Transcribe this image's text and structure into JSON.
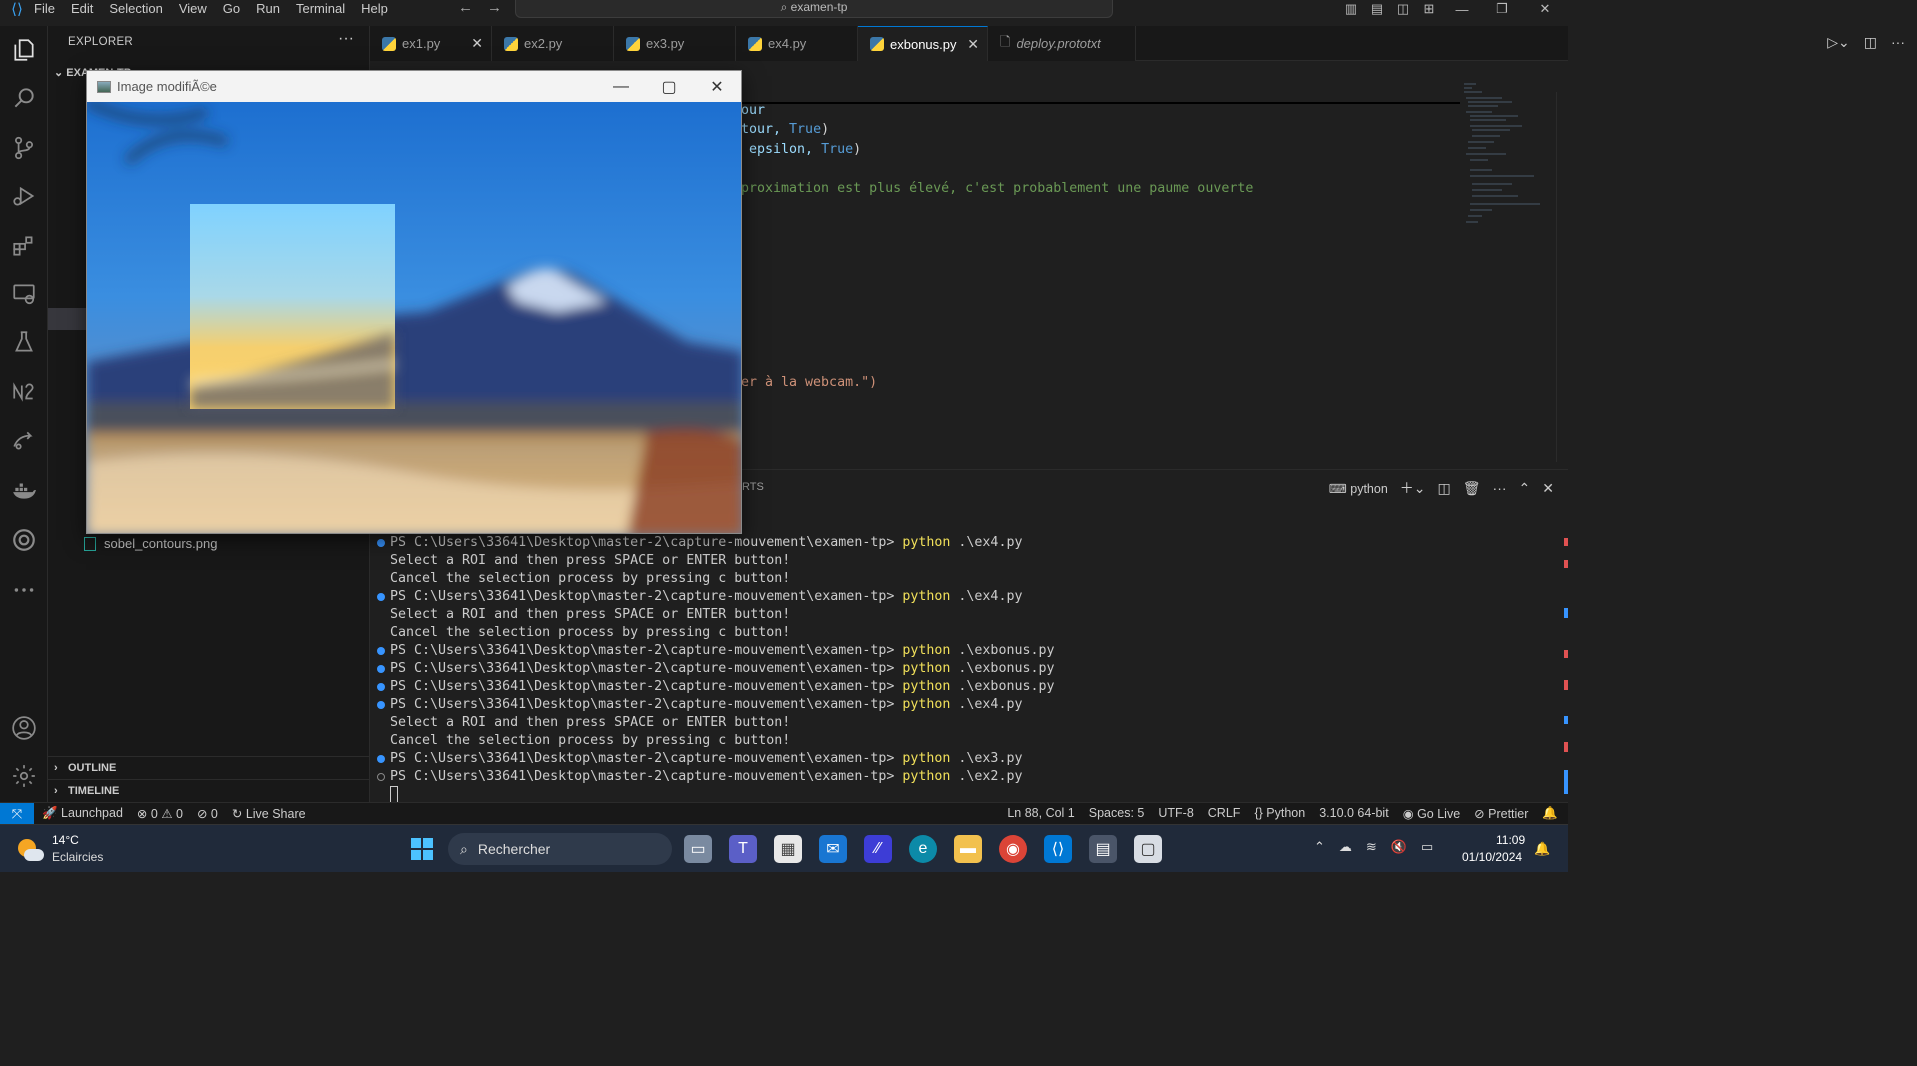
{
  "titlebar": {
    "menu": [
      "File",
      "Edit",
      "Selection",
      "View",
      "Go",
      "Run",
      "Terminal",
      "Help"
    ],
    "search": "examen-tp"
  },
  "sidebar": {
    "header": "EXPLORER",
    "folder": "EXAMEN-TP",
    "file": "sobel_contours.png",
    "outline": "OUTLINE",
    "timeline": "TIMELINE"
  },
  "tabs": [
    {
      "label": "ex1.py",
      "active": false
    },
    {
      "label": "ex2.py",
      "active": false
    },
    {
      "label": "ex3.py",
      "active": false
    },
    {
      "label": "ex4.py",
      "active": false
    },
    {
      "label": "exbonus.py",
      "active": true
    },
    {
      "label": "deploy.prototxt",
      "active": false
    }
  ],
  "code": {
    "line1": "our",
    "line2_a": "tour, ",
    "line2_b": "True",
    "line2_c": ")",
    "line3_a": " epsilon, ",
    "line3_b": "True",
    "line3_c": ")",
    "line4": "proximation est plus élevé, c'est probablement une paume ouverte",
    "line5": "er à la webcam.\")"
  },
  "panel": {
    "tab_partial": "RTS",
    "terminal_name": "python"
  },
  "terminal": [
    {
      "prompt": "PS C:\\Users\\33641\\Desktop\\master-2\\capture-mouvement\\examen-tp> ",
      "cmd": "python",
      "arg": " .\\ex4.py",
      "dot": "filled"
    },
    {
      "text": "Select a ROI and then press SPACE or ENTER button!"
    },
    {
      "text": "Cancel the selection process by pressing c button!"
    },
    {
      "prompt": "PS C:\\Users\\33641\\Desktop\\master-2\\capture-mouvement\\examen-tp> ",
      "cmd": "python",
      "arg": " .\\ex4.py",
      "dot": "filled"
    },
    {
      "text": "Select a ROI and then press SPACE or ENTER button!"
    },
    {
      "text": "Cancel the selection process by pressing c button!"
    },
    {
      "prompt": "PS C:\\Users\\33641\\Desktop\\master-2\\capture-mouvement\\examen-tp> ",
      "cmd": "python",
      "arg": " .\\exbonus.py",
      "dot": "filled"
    },
    {
      "prompt": "PS C:\\Users\\33641\\Desktop\\master-2\\capture-mouvement\\examen-tp> ",
      "cmd": "python",
      "arg": " .\\exbonus.py",
      "dot": "filled"
    },
    {
      "prompt": "PS C:\\Users\\33641\\Desktop\\master-2\\capture-mouvement\\examen-tp> ",
      "cmd": "python",
      "arg": " .\\exbonus.py",
      "dot": "filled"
    },
    {
      "prompt": "PS C:\\Users\\33641\\Desktop\\master-2\\capture-mouvement\\examen-tp> ",
      "cmd": "python",
      "arg": " .\\ex4.py",
      "dot": "filled"
    },
    {
      "text": "Select a ROI and then press SPACE or ENTER button!"
    },
    {
      "text": "Cancel the selection process by pressing c button!"
    },
    {
      "prompt": "PS C:\\Users\\33641\\Desktop\\master-2\\capture-mouvement\\examen-tp> ",
      "cmd": "python",
      "arg": " .\\ex3.py",
      "dot": "filled"
    },
    {
      "prompt": "PS C:\\Users\\33641\\Desktop\\master-2\\capture-mouvement\\examen-tp> ",
      "cmd": "python",
      "arg": " .\\ex2.py",
      "dot": "hollow"
    }
  ],
  "statusbar": {
    "launchpad": "Launchpad",
    "errors": "0",
    "warnings": "0",
    "ports": "0",
    "liveshare": "Live Share",
    "position": "Ln 88, Col 1",
    "spaces": "Spaces: 5",
    "encoding": "UTF-8",
    "eol": "CRLF",
    "language": "Python",
    "interpreter": "3.10.0 64-bit",
    "golive": "Go Live",
    "prettier": "Prettier"
  },
  "imagewindow": {
    "title": "Image modifiÃ©e"
  },
  "taskbar": {
    "temp": "14°C",
    "weather": "Eclaircies",
    "search": "Rechercher",
    "time": "11:09",
    "date": "01/10/2024"
  },
  "colors": {
    "accent": "#0078d4",
    "python_cmd": "#f1e05a"
  }
}
